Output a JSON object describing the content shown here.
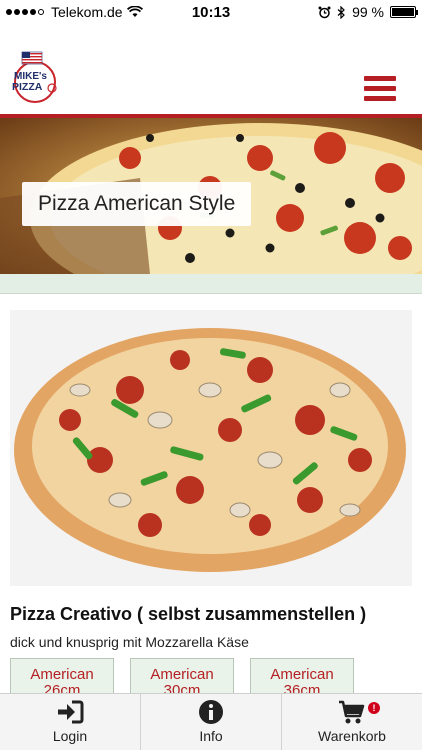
{
  "status_bar": {
    "carrier": "Telekom.de",
    "time": "10:13",
    "battery": "99 %",
    "battery_level": 0.99
  },
  "header": {
    "logo_text": "MIKE's PIZZA",
    "menu_icon": "hamburger-icon"
  },
  "banner": {
    "title": "Pizza American Style"
  },
  "product": {
    "title": "Pizza Creativo ( selbst zusammenstellen )",
    "description": "dick und knusprig mit Mozzarella Käse",
    "sizes": [
      {
        "label": "American",
        "size": "26cm"
      },
      {
        "label": "American",
        "size": "30cm"
      },
      {
        "label": "American",
        "size": "36cm"
      }
    ]
  },
  "tabbar": {
    "items": [
      {
        "label": "Login",
        "icon": "login-icon"
      },
      {
        "label": "Info",
        "icon": "info-icon"
      },
      {
        "label": "Warenkorb",
        "icon": "cart-icon",
        "badge": "!"
      }
    ]
  },
  "colors": {
    "brand_red": "#b51f24",
    "size_button_bg": "#e9f3e9",
    "strip_green": "#e3efe4"
  }
}
